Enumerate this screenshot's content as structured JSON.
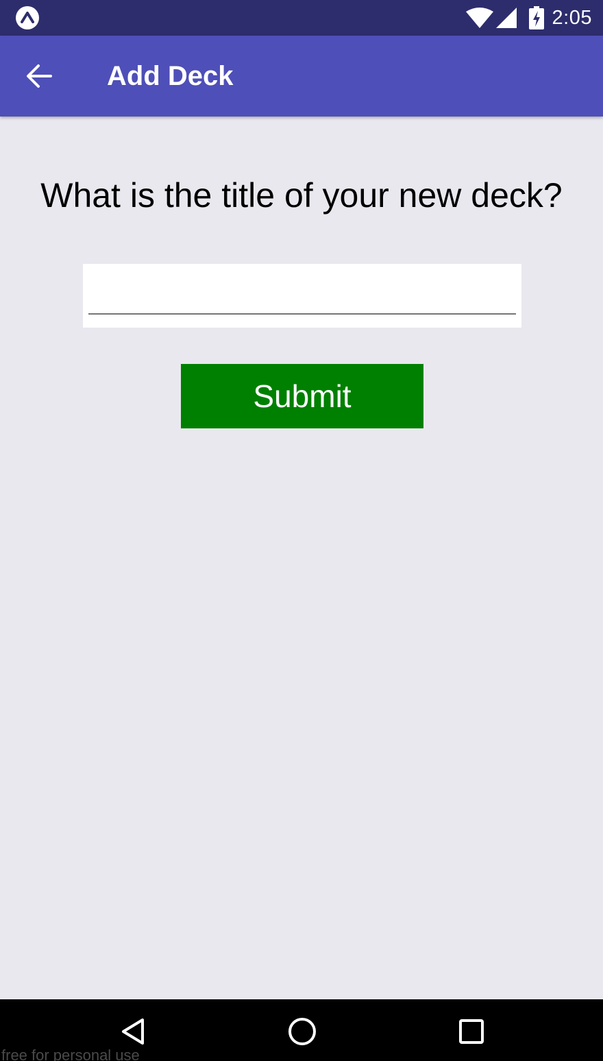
{
  "status_bar": {
    "time": "2:05",
    "icons": [
      "expo-icon",
      "wifi-icon",
      "signal-icon",
      "battery-charging-icon"
    ]
  },
  "app_bar": {
    "title": "Add Deck",
    "back_icon": "arrow-back-icon"
  },
  "form": {
    "question": "What is the title of your new deck?",
    "title_input_value": "",
    "submit_label": "Submit"
  },
  "nav_bar": {
    "icons": [
      "nav-back-icon",
      "nav-home-icon",
      "nav-recents-icon"
    ]
  },
  "watermark": "free for personal use",
  "colors": {
    "status_bar": "#2d2d6d",
    "app_bar": "#4e4fb8",
    "background": "#e9e8ee",
    "submit_button": "#008000",
    "nav_bar": "#000000"
  }
}
